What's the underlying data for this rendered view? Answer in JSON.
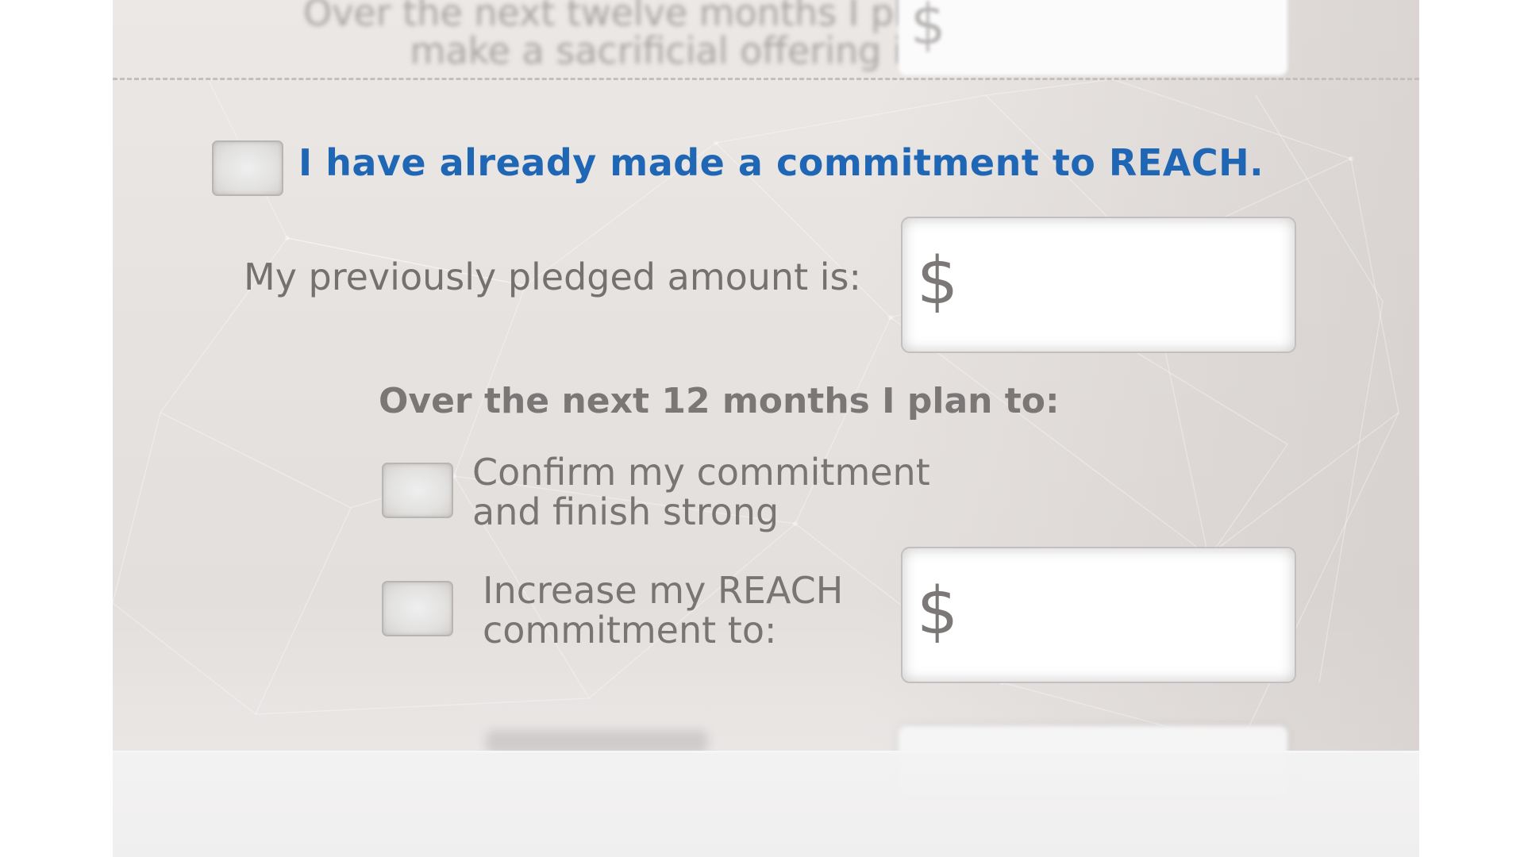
{
  "form": {
    "blurred_header_text": "Over the next twelve months I plan to make a sacrificial offering in the",
    "currency_symbol": "$",
    "already_committed": {
      "label": "I have already made a commitment to REACH.",
      "checked": false
    },
    "previous_pledge": {
      "label": "My previously pledged amount is:",
      "value": ""
    },
    "plan_heading": "Over the next 12 months I plan to:",
    "options": [
      {
        "label": "Confirm my commitment and finish strong",
        "checked": false
      },
      {
        "label": "Increase my REACH commitment to:",
        "checked": false,
        "value": ""
      }
    ]
  },
  "colors": {
    "accent": "#1f66b5",
    "label_gray": "#747171"
  }
}
